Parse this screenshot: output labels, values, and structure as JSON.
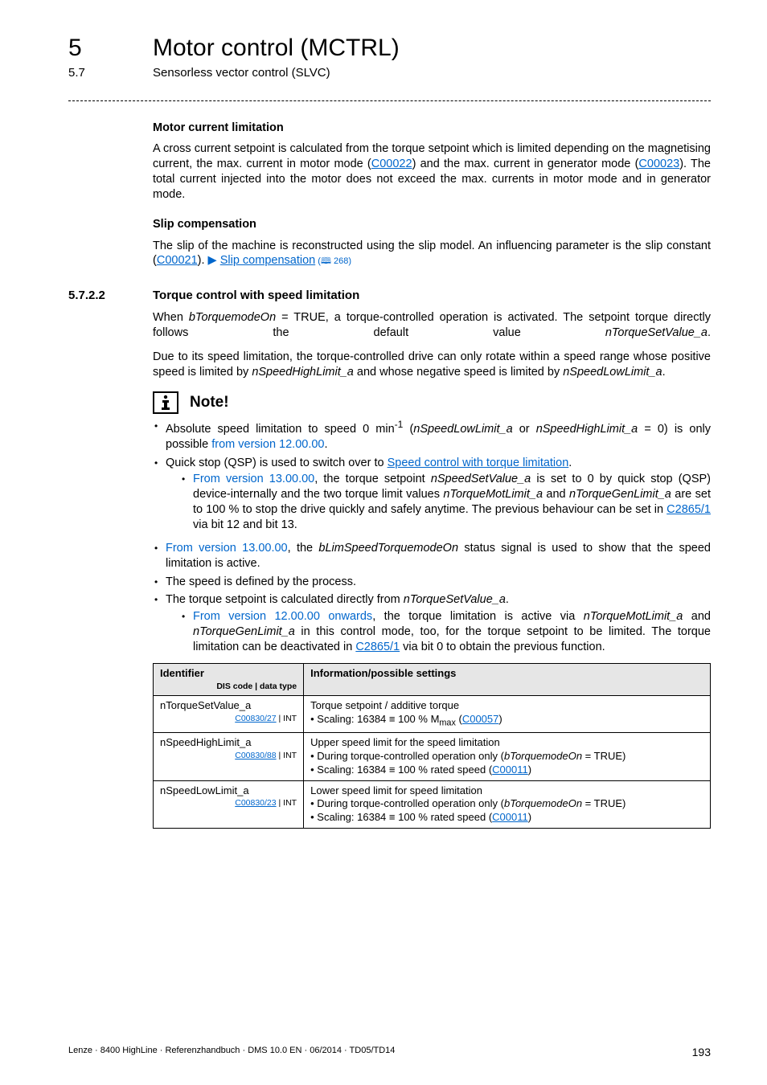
{
  "header": {
    "chapter_num": "5",
    "chapter_title": "Motor control (MCTRL)",
    "sub_num": "5.7",
    "sub_title": "Sensorless vector control (SLVC)"
  },
  "sec1": {
    "h1": "Motor current limitation",
    "p1a": "A cross current setpoint is calculated from the torque setpoint which is limited depending on the magnetising current, the max. current in motor mode (",
    "p1_link1": "C00022",
    "p1b": ") and the max. current in generator mode (",
    "p1_link2": "C00023",
    "p1c": "). The total current injected into the motor does not exceed the max. currents in motor mode and in  generator mode.",
    "h2": "Slip compensation",
    "p2a": "The slip of the machine is reconstructed using the slip model. An influencing parameter is the slip constant (",
    "p2_link1": "C00021",
    "p2b": ").  ",
    "p2_arrow": "▶",
    "p2_link2": "Slip compensation",
    "p2_ref": " (🕮 268)"
  },
  "sec572": {
    "num": "5.7.2.2",
    "title": "Torque control with speed limitation",
    "p1a": "When ",
    "p1i1": "bTorquemodeOn",
    "p1b": " = TRUE, a torque-controlled operation is activated. The setpoint torque directly follows the default value ",
    "p1i2": "nTorqueSetValue_a",
    "p1c": ".",
    "p2a": "Due to its speed limitation, the torque-controlled drive can only rotate within a speed range whose positive speed is limited by ",
    "p2i1": "nSpeedHighLimit_a",
    "p2b": " and whose negative speed is limited by ",
    "p2i2": "nSpeedLowLimit_a",
    "p2c": "."
  },
  "note": {
    "label": "Note!",
    "b1a": "Absolute speed limitation to speed 0 min",
    "b1sup": "-1",
    "b1b": " (",
    "b1i1": "nSpeedLowLimit_a",
    "b1c": " or ",
    "b1i2": "nSpeedHighLimit_a",
    "b1d": " = 0) is only possible ",
    "b1blue": "from version 12.00.00",
    "b1e": ".",
    "b2a": "Quick stop (QSP) is used to switch over to ",
    "b2link": "Speed control with torque limitation",
    "b2b": ".",
    "b2s1blue": "From version 13.00.00",
    "b2s1a": ", the torque setpoint ",
    "b2s1i1": "nSpeedSetValue_a",
    "b2s1b": " is set to 0 by quick stop (QSP) device-internally and the two torque limit values ",
    "b2s1i2": "nTorqueMotLimit_a",
    "b2s1c": " and ",
    "b2s1i3": "nTorqueGenLimit_a",
    "b2s1d": " are set to 100 % to stop the drive quickly and safely anytime. The previous behaviour can be set in ",
    "b2s1link": "C2865/1",
    "b2s1e": " via bit 12 and bit 13."
  },
  "body": {
    "b1blue": "From version 13.00.00",
    "b1a": ", the ",
    "b1i": "bLimSpeedTorquemodeOn",
    "b1b": " status signal is used to show that the speed limitation is active.",
    "b2": "The speed is defined by the process.",
    "b3a": "The torque setpoint is calculated directly from ",
    "b3i": "nTorqueSetValue_a",
    "b3b": ".",
    "b3s1blue": "From version 12.00.00 onwards",
    "b3s1a": ", the torque limitation is active via ",
    "b3s1i1": "nTorqueMotLimit_a",
    "b3s1b": " and ",
    "b3s1i2": "nTorqueGenLimit_a",
    "b3s1c": " in this control mode, too, for the torque setpoint to be limited. The torque limitation can be deactivated in ",
    "b3s1link": "C2865/1",
    "b3s1d": " via bit 0 to obtain the previous function."
  },
  "table": {
    "th1": "Identifier",
    "th1sub": "DIS code | data type",
    "th2": "Information/possible settings",
    "r1c1a": "nTorqueSetValue_a",
    "r1c1b_link": "C00830/27",
    "r1c1b_rest": " | INT",
    "r1c2a": "Torque setpoint / additive torque",
    "r1c2b": "• Scaling: 16384 ≡ 100 % M",
    "r1c2sub": "max",
    "r1c2c": " (",
    "r1c2link": "C00057",
    "r1c2d": ")",
    "r2c1a": "nSpeedHighLimit_a",
    "r2c1b_link": "C00830/88",
    "r2c1b_rest": " | INT",
    "r2c2a": "Upper speed limit for the speed limitation",
    "r2c2b": "• During torque-controlled operation only (",
    "r2c2i": "bTorquemodeOn",
    "r2c2c": " = TRUE)",
    "r2c2d": "• Scaling: 16384 ≡ 100 % rated speed (",
    "r2c2link": "C00011",
    "r2c2e": ")",
    "r3c1a": "nSpeedLowLimit_a",
    "r3c1b_link": "C00830/23",
    "r3c1b_rest": " | INT",
    "r3c2a": "Lower speed limit for speed limitation",
    "r3c2b": "• During torque-controlled operation only (",
    "r3c2i": "bTorquemodeOn",
    "r3c2c": " = TRUE)",
    "r3c2d": "• Scaling: 16384 ≡ 100 % rated speed (",
    "r3c2link": "C00011",
    "r3c2e": ")"
  },
  "footer": {
    "left": "Lenze · 8400 HighLine · Referenzhandbuch · DMS 10.0 EN · 06/2014 · TD05/TD14",
    "right": "193"
  }
}
